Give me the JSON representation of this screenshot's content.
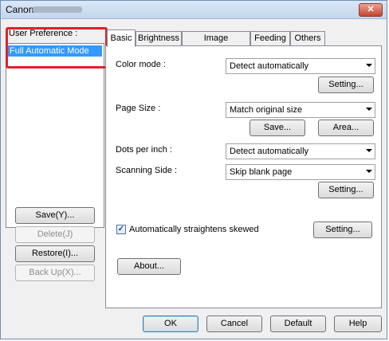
{
  "window": {
    "title": "Canon",
    "close_symbol": "✕"
  },
  "preferences": {
    "label": "User Preference :",
    "items": [
      "Full Automatic Mode"
    ],
    "buttons": {
      "save": "Save(Y)...",
      "delete": "Delete(J)",
      "restore": "Restore(I)...",
      "backup": "Back Up(X)..."
    }
  },
  "tabs": [
    "Basic",
    "Brightness",
    "Image processing",
    "Feeding",
    "Others"
  ],
  "basic": {
    "color_mode": {
      "label": "Color mode :",
      "value": "Detect automatically",
      "setting": "Setting..."
    },
    "page_size": {
      "label": "Page Size :",
      "value": "Match original size",
      "save": "Save...",
      "area": "Area..."
    },
    "dpi": {
      "label": "Dots per inch :",
      "value": "Detect automatically"
    },
    "scanning_side": {
      "label": "Scanning Side :",
      "value": "Skip blank page",
      "setting": "Setting..."
    },
    "straighten": {
      "label": "Automatically straightens skewed",
      "checked": true,
      "setting": "Setting..."
    },
    "about": "About..."
  },
  "footer": {
    "ok": "OK",
    "cancel": "Cancel",
    "default": "Default",
    "help": "Help"
  }
}
